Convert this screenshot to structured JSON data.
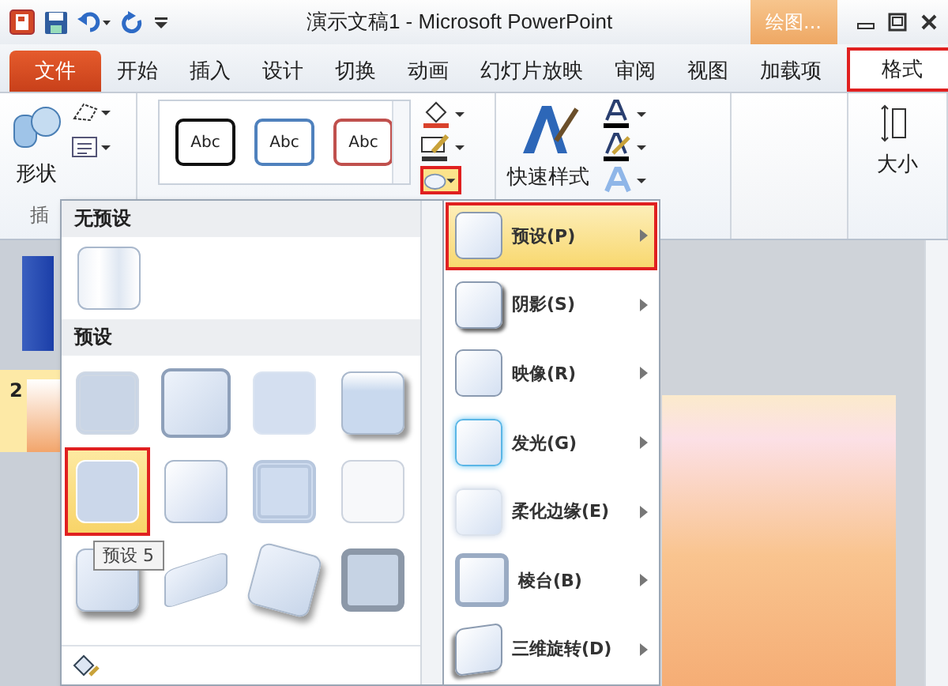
{
  "window": {
    "title": "演示文稿1 - Microsoft PowerPoint",
    "context_tab": "绘图..."
  },
  "tabs": [
    {
      "label": "文件",
      "kind": "file",
      "selected": false
    },
    {
      "label": "开始",
      "kind": "tab",
      "selected": false
    },
    {
      "label": "插入",
      "kind": "tab",
      "selected": false
    },
    {
      "label": "设计",
      "kind": "tab",
      "selected": false
    },
    {
      "label": "切换",
      "kind": "tab",
      "selected": false
    },
    {
      "label": "动画",
      "kind": "tab",
      "selected": false
    },
    {
      "label": "幻灯片放映",
      "kind": "tab",
      "selected": false
    },
    {
      "label": "审阅",
      "kind": "tab",
      "selected": false
    },
    {
      "label": "视图",
      "kind": "tab",
      "selected": false
    },
    {
      "label": "加载项",
      "kind": "tab",
      "selected": false
    },
    {
      "label": "格式",
      "kind": "tab",
      "selected": true
    }
  ],
  "ribbon": {
    "shapes_label": "形状",
    "insert_group_label": "插",
    "style_samples": [
      {
        "label": "Abc",
        "color": "#111111"
      },
      {
        "label": "Abc",
        "color": "#4f81bd"
      },
      {
        "label": "Abc",
        "color": "#c0504d"
      }
    ],
    "effects_highlighted": true,
    "quick_styles_label": "快速样式",
    "size_label": "大小"
  },
  "slides": [
    {
      "number": "2",
      "selected": true
    }
  ],
  "gallery": {
    "no_preset_heading": "无预设",
    "preset_heading": "预设",
    "presets": [
      {
        "selected": false
      },
      {
        "selected": false
      },
      {
        "selected": false
      },
      {
        "selected": false
      },
      {
        "selected": true
      },
      {
        "selected": false
      },
      {
        "selected": false
      },
      {
        "selected": false
      },
      {
        "selected": false
      },
      {
        "selected": false
      },
      {
        "selected": false
      },
      {
        "selected": false
      }
    ],
    "tooltip": "预设 5"
  },
  "effects_menu": [
    {
      "label": "预设(P)",
      "selected": true
    },
    {
      "label": "阴影(S)",
      "selected": false
    },
    {
      "label": "映像(R)",
      "selected": false
    },
    {
      "label": "发光(G)",
      "selected": false
    },
    {
      "label": "柔化边缘(E)",
      "selected": false
    },
    {
      "label": "棱台(B)",
      "selected": false
    },
    {
      "label": "三维旋转(D)",
      "selected": false
    }
  ]
}
